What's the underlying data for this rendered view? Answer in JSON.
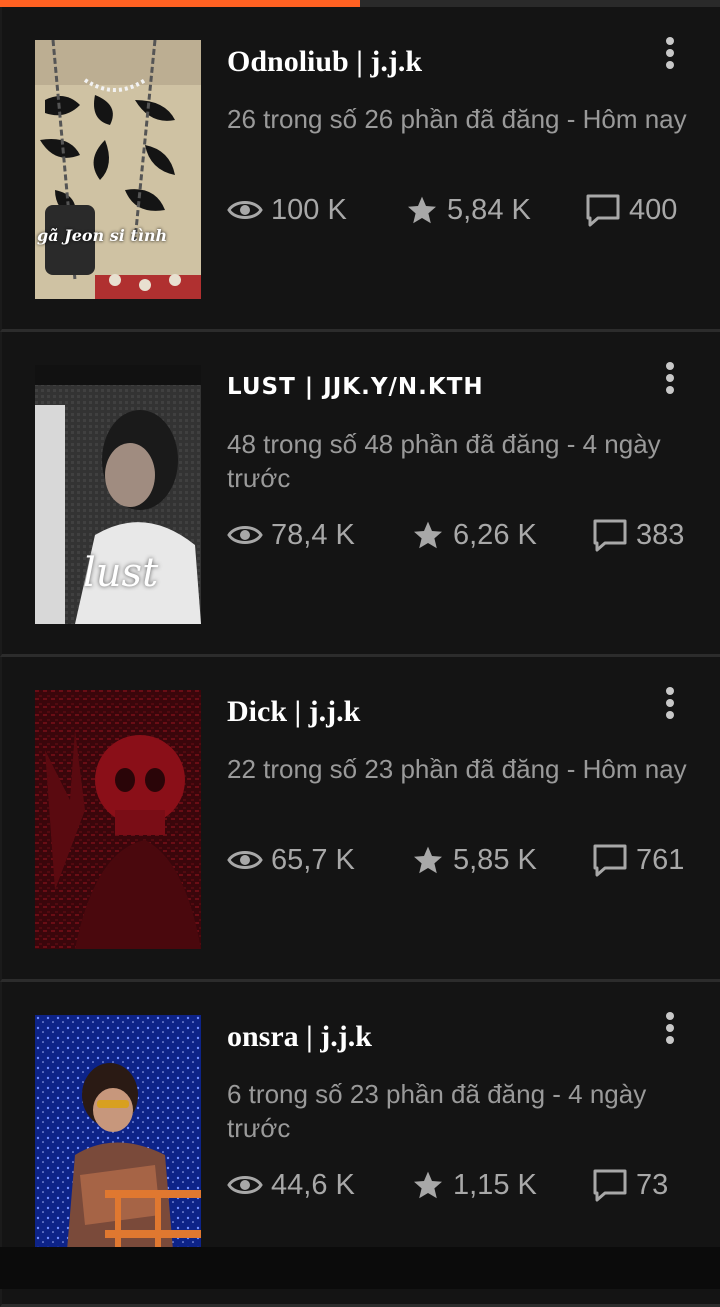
{
  "reading_progress": 0.5,
  "colors": {
    "accent": "#ff6122",
    "background": "#121212"
  },
  "stories": [
    {
      "title": "Odnoliub | j.j.k",
      "parts": "26 trong số 26 phần đã đăng - Hôm nay",
      "reads": "100 K",
      "votes": "5,84 K",
      "comments": "400",
      "cover_text": "gã Jeon si tình"
    },
    {
      "title": "LUST | JJK.Y/N.KTH",
      "parts": "48 trong số 48 phần đã đăng - 4 ngày trước",
      "reads": "78,4 K",
      "votes": "6,26 K",
      "comments": "383",
      "cover_text": "lust"
    },
    {
      "title": "Dick | j.j.k",
      "parts": "22 trong số 23 phần đã đăng - Hôm nay",
      "reads": "65,7 K",
      "votes": "5,85 K",
      "comments": "761"
    },
    {
      "title": "onsra | j.j.k",
      "parts": "6 trong số 23 phần đã đăng - 4 ngày trước",
      "reads": "44,6 K",
      "votes": "1,15 K",
      "comments": "73"
    }
  ],
  "icons": {
    "reads": "eye-icon",
    "votes": "star-icon",
    "comments": "comment-icon",
    "menu": "more-vertical-icon"
  }
}
